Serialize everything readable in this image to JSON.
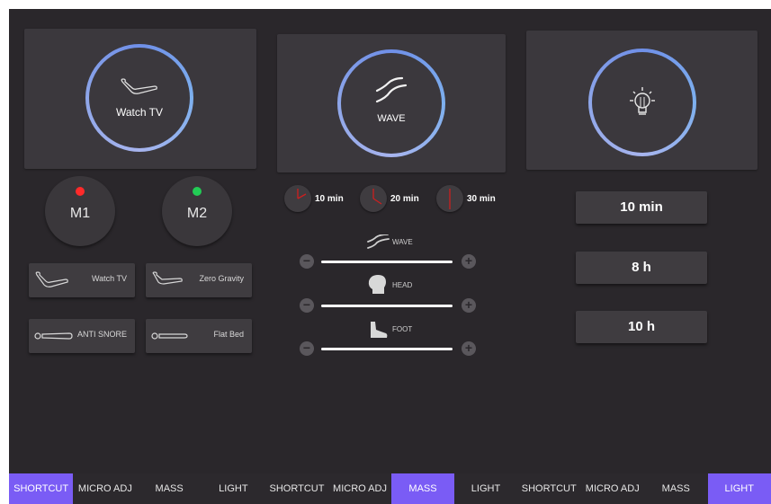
{
  "shortcut_panel": {
    "hero": {
      "label": "Watch TV",
      "icon": "recliner-icon"
    },
    "memory": [
      {
        "label": "M1",
        "status_color": "#ff2a2a"
      },
      {
        "label": "M2",
        "status_color": "#22cc55"
      }
    ],
    "presets": [
      {
        "label": "Watch TV",
        "icon": "recliner-icon"
      },
      {
        "label": "Zero Gravity",
        "icon": "zero-gravity-icon"
      },
      {
        "label": "ANTI SNORE",
        "icon": "anti-snore-icon"
      },
      {
        "label": "Flat Bed",
        "icon": "flat-bed-icon"
      }
    ],
    "tabs": [
      "SHORTCUT",
      "MICRO ADJ",
      "MASS",
      "LIGHT"
    ],
    "active_tab": "SHORTCUT"
  },
  "massage_panel": {
    "hero": {
      "label": "WAVE",
      "icon": "wave-icon"
    },
    "timers": [
      "10 min",
      "20 min",
      "30 min"
    ],
    "sliders": [
      {
        "label": "WAVE",
        "icon": "wave-icon"
      },
      {
        "label": "HEAD",
        "icon": "head-icon"
      },
      {
        "label": "FOOT",
        "icon": "foot-icon"
      }
    ],
    "tabs": [
      "SHORTCUT",
      "MICRO ADJ",
      "MASS",
      "LIGHT"
    ],
    "active_tab": "MASS"
  },
  "light_panel": {
    "hero": {
      "icon": "light-bulb-icon"
    },
    "options": [
      "10 min",
      "8 h",
      "10 h"
    ],
    "tabs": [
      "SHORTCUT",
      "MICRO ADJ",
      "MASS",
      "LIGHT"
    ],
    "active_tab": "LIGHT"
  },
  "colors": {
    "accent": "#7a5cf5",
    "ring": "#8ea6e9",
    "background": "#2a272b"
  }
}
